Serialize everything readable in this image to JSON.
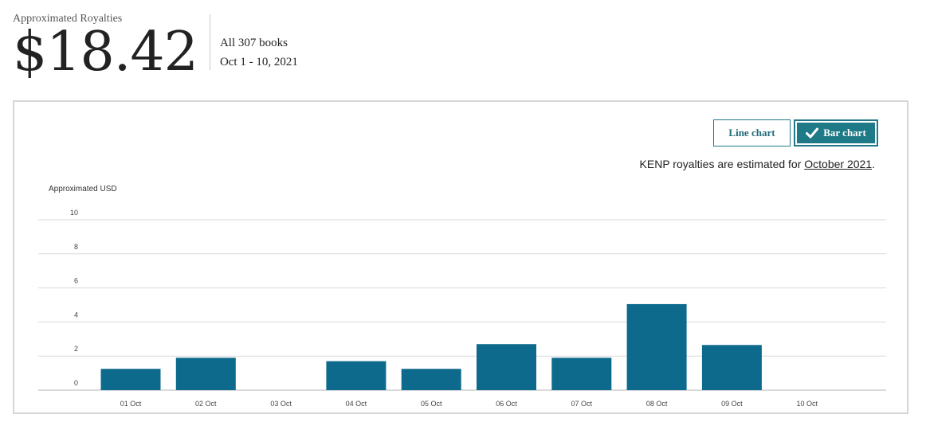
{
  "summary": {
    "label": "Approximated Royalties",
    "amount": "$18.42",
    "books": "All 307 books",
    "date_range": "Oct 1 - 10, 2021"
  },
  "toggle": {
    "line_label": "Line chart",
    "bar_label": "Bar chart",
    "selected": "bar"
  },
  "note": {
    "prefix": "KENP royalties are estimated for ",
    "link": "October 2021",
    "suffix": "."
  },
  "colors": {
    "bar": "#0e6a8c",
    "accent": "#1f7a88"
  },
  "chart_data": {
    "type": "bar",
    "ylabel": "Approximated USD",
    "ylim": [
      0,
      10
    ],
    "yticks": [
      0,
      2,
      4,
      6,
      8,
      10
    ],
    "grid": true,
    "categories": [
      "01 Oct",
      "02 Oct",
      "03 Oct",
      "04 Oct",
      "05 Oct",
      "06 Oct",
      "07 Oct",
      "08 Oct",
      "09 Oct",
      "10 Oct"
    ],
    "values": [
      1.25,
      1.9,
      0,
      1.7,
      1.25,
      2.7,
      1.9,
      5.05,
      2.65,
      0
    ]
  }
}
